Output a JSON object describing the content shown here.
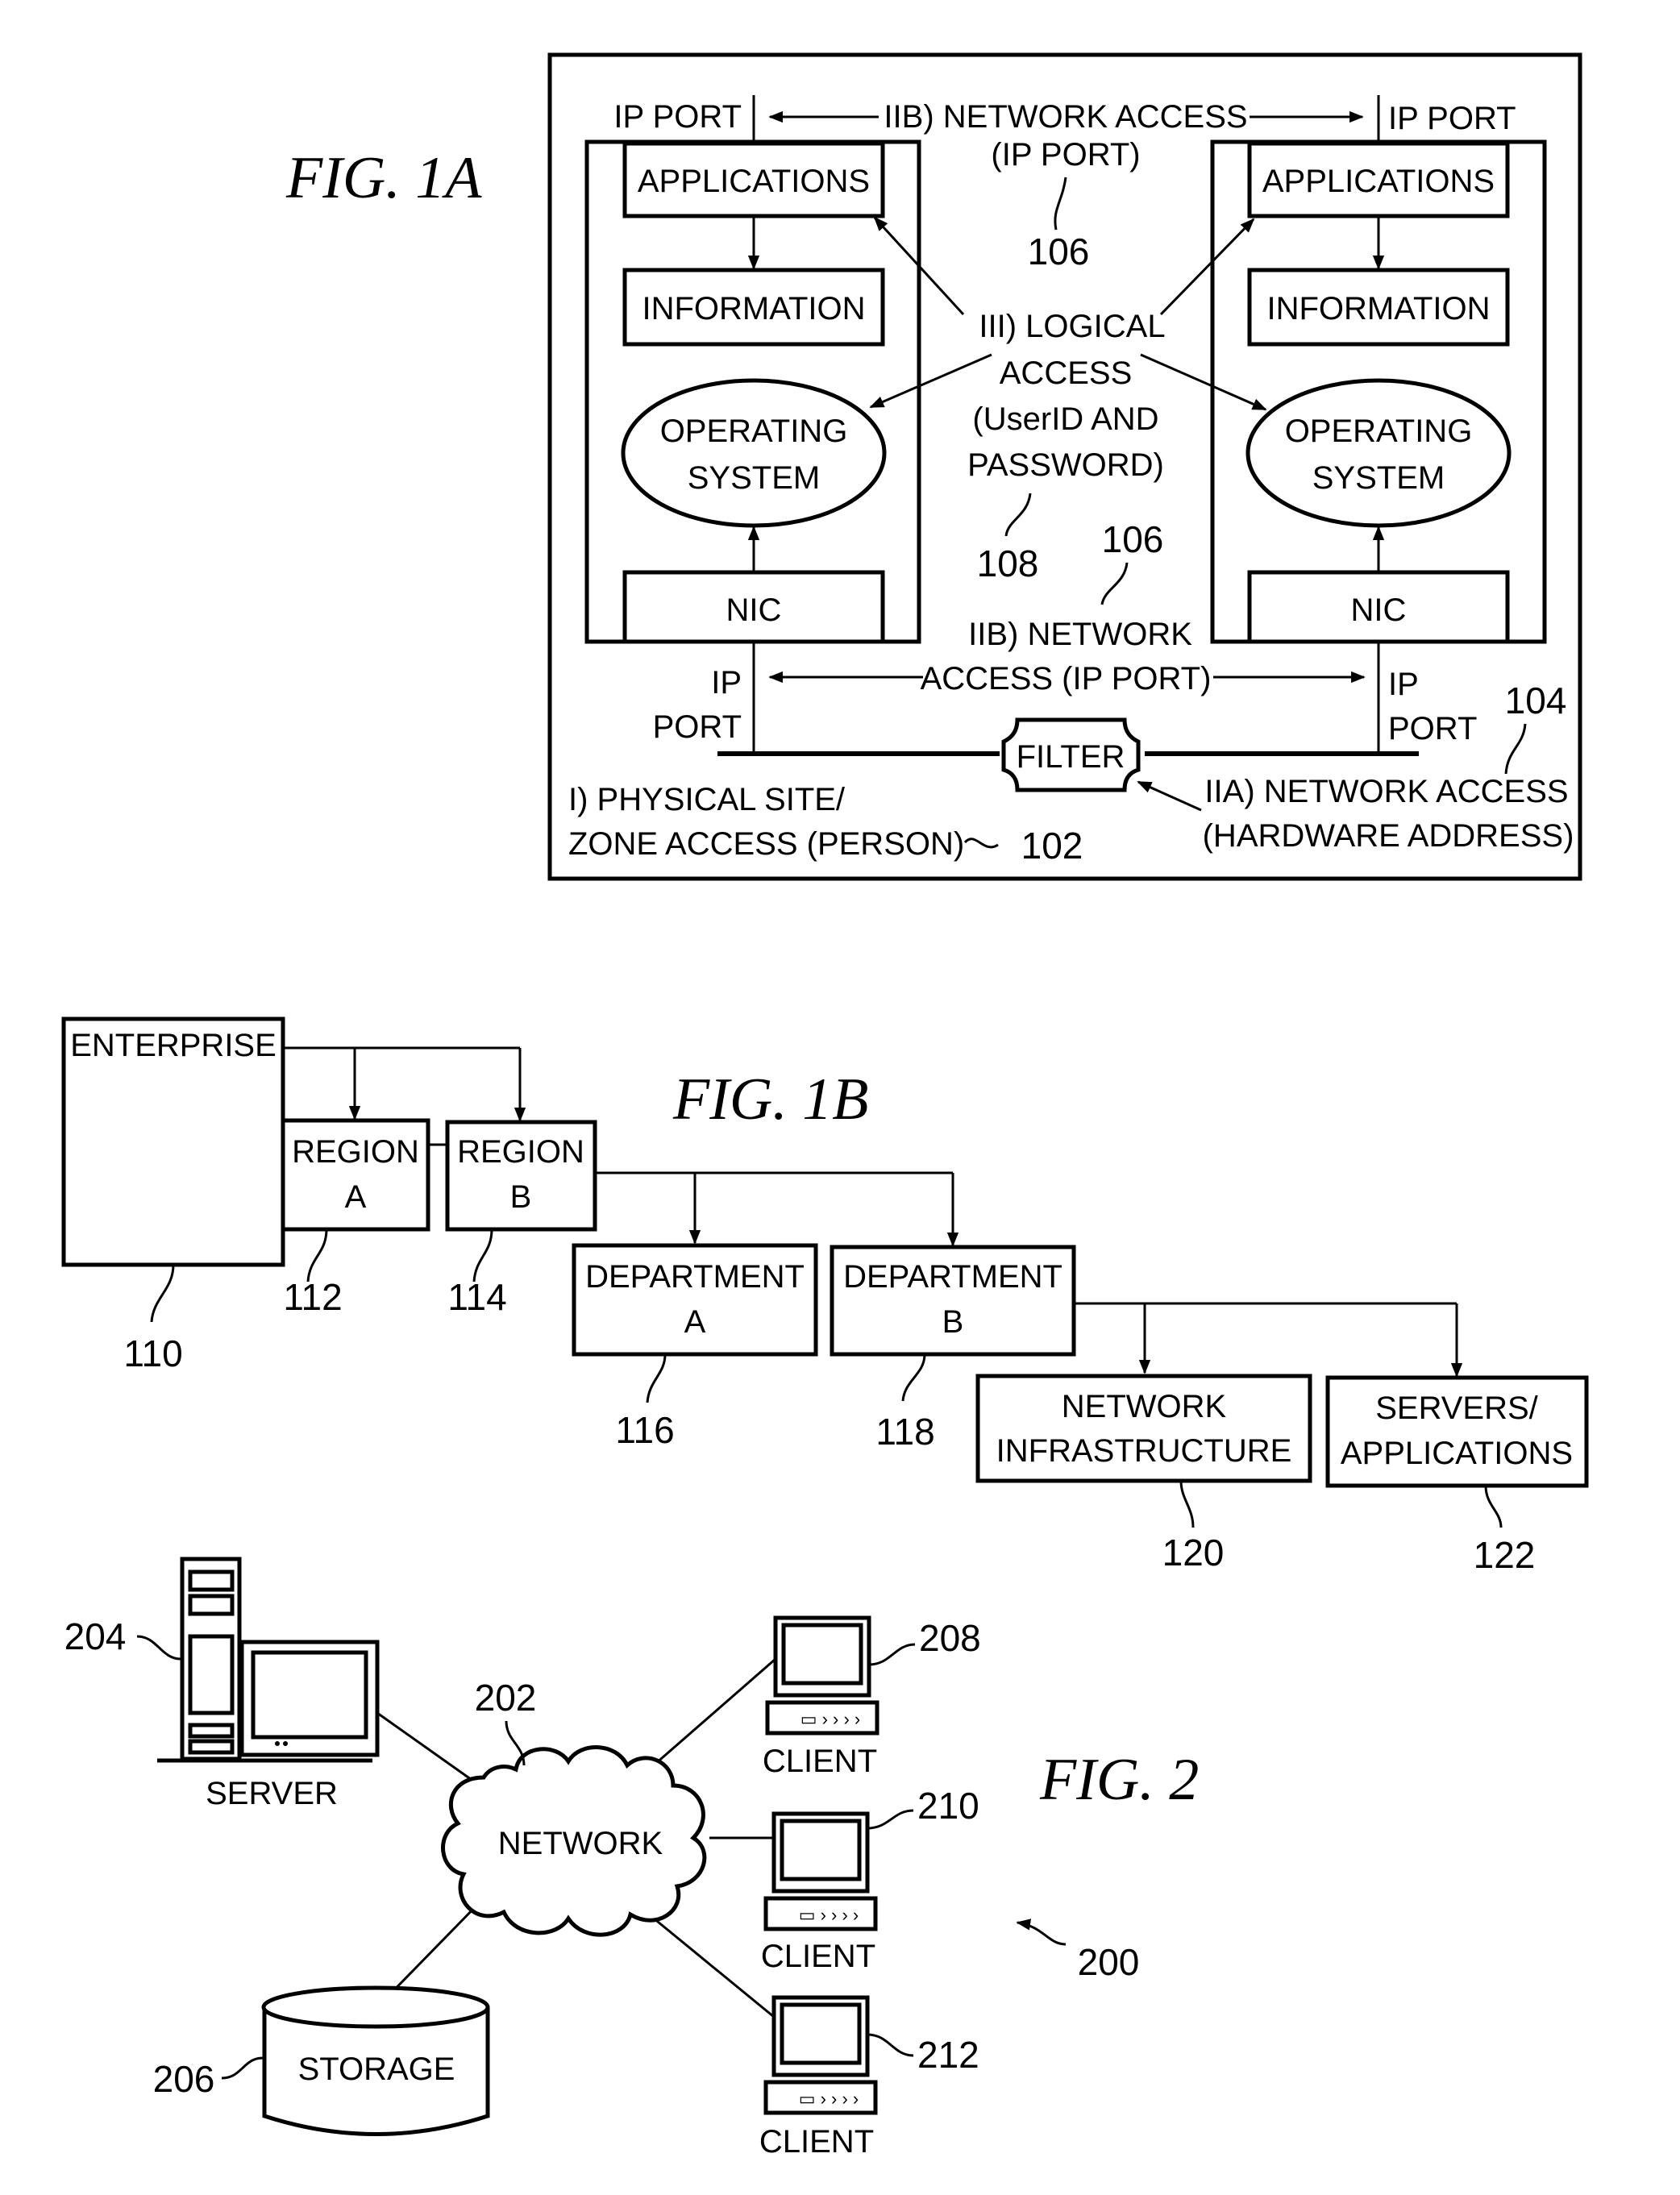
{
  "figures": {
    "fig1a": {
      "title": "FIG. 1A",
      "left_host": {
        "port_label": "IP PORT",
        "applications": "APPLICATIONS",
        "information": "INFORMATION",
        "os_line1": "OPERATING",
        "os_line2": "SYSTEM",
        "nic": "NIC",
        "bottom_port_line1": "IP",
        "bottom_port_line2": "PORT"
      },
      "right_host": {
        "port_label": "IP PORT",
        "applications": "APPLICATIONS",
        "information": "INFORMATION",
        "os_line1": "OPERATING",
        "os_line2": "SYSTEM",
        "nic": "NIC",
        "bottom_port_line1": "IP",
        "bottom_port_line2": "PORT"
      },
      "top_network_access_line1": "IIB) NETWORK ACCESS",
      "top_network_access_line2": "(IP PORT)",
      "top_ref": "106",
      "logical_access_lines": [
        "III) LOGICAL",
        "ACCESS",
        "(UserID AND",
        "PASSWORD)"
      ],
      "logical_ref": "108",
      "bottom_ref_106": "106",
      "bottom_network_access_line1": "IIB) NETWORK",
      "bottom_network_access_line2": "ACCESS (IP PORT)",
      "filter": "FILTER",
      "ref_104": "104",
      "hardware_access_line1": "IIA) NETWORK ACCESS",
      "hardware_access_line2": "(HARDWARE ADDRESS)",
      "physical_line1": "I) PHYSICAL SITE/",
      "physical_line2": "ZONE ACCESS (PERSON)",
      "ref_102": "102"
    },
    "fig1b": {
      "title": "FIG. 1B",
      "nodes": {
        "enterprise": {
          "label": "ENTERPRISE",
          "ref": "110"
        },
        "region_a": {
          "line1": "REGION",
          "line2": "A",
          "ref": "112"
        },
        "region_b": {
          "line1": "REGION",
          "line2": "B",
          "ref": "114"
        },
        "department_a": {
          "line1": "DEPARTMENT",
          "line2": "A",
          "ref": "116"
        },
        "department_b": {
          "line1": "DEPARTMENT",
          "line2": "B",
          "ref": "118"
        },
        "network_infra": {
          "line1": "NETWORK",
          "line2": "INFRASTRUCTURE",
          "ref": "120"
        },
        "servers_apps": {
          "line1": "SERVERS/",
          "line2": "APPLICATIONS",
          "ref": "122"
        }
      }
    },
    "fig2": {
      "title": "FIG. 2",
      "system_ref": "200",
      "network": {
        "label": "NETWORK",
        "ref": "202"
      },
      "server": {
        "label": "SERVER",
        "ref": "204"
      },
      "storage": {
        "label": "STORAGE",
        "ref": "206"
      },
      "clients": [
        {
          "label": "CLIENT",
          "ref": "208"
        },
        {
          "label": "CLIENT",
          "ref": "210"
        },
        {
          "label": "CLIENT",
          "ref": "212"
        }
      ]
    }
  }
}
